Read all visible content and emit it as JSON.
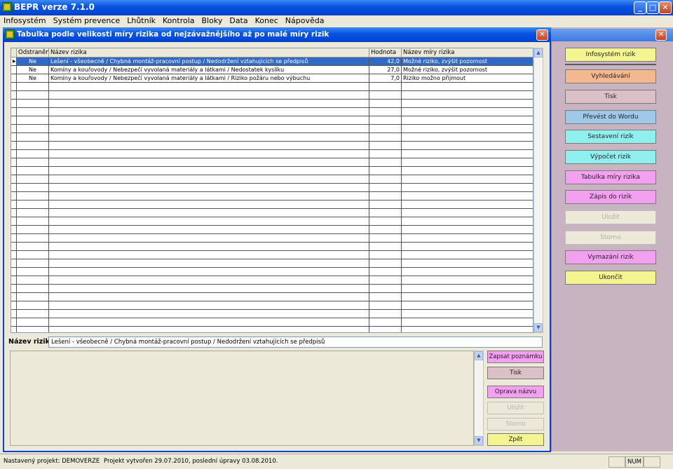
{
  "app": {
    "title": "BEPR verze 7.1.0"
  },
  "menu": [
    "Infosystém",
    "Systém prevence",
    "Lhůtník",
    "Kontrola",
    "Bloky",
    "Data",
    "Konec",
    "Nápověda"
  ],
  "subwindow": {
    "title": "Tabulka podle velikosti míry rizika od nejzávažnějšího až po malé míry rizik"
  },
  "grid": {
    "columns": [
      "Odstraněno",
      "Název rizika",
      "Hodnota",
      "Název míry rizika"
    ],
    "rows": [
      {
        "odstraneno": "Ne",
        "nazev": "Lešení - všeobecně / Chybná montáž-pracovní postup / Nedodržení vztahujících se předpisů",
        "hodnota": "42,0",
        "mira": "Možné riziko, zvýšit pozornost",
        "selected": true
      },
      {
        "odstraneno": "Ne",
        "nazev": "Komíny a kouřovody / Nebezpečí vyvolaná materiály a látkami / Nedostatek kyslíku",
        "hodnota": "27,0",
        "mira": "Možné riziko, zvýšit pozornost",
        "selected": false
      },
      {
        "odstraneno": "Ne",
        "nazev": "Komíny a kouřovody / Nebezpečí vyvolaná materiály a látkami / Riziko požáru nebo výbuchu",
        "hodnota": "7,0",
        "mira": "Riziko možno přijmout",
        "selected": false
      }
    ]
  },
  "name_field": {
    "label": "Název rizika",
    "value": "Lešení - všeobecně / Chybná montáž-pracovní postup / Nedodržení vztahujících se předpisů"
  },
  "bottom_buttons": [
    {
      "label": "Zapsat poznámku",
      "color": "#f4a0f0",
      "enabled": true
    },
    {
      "label": "Tisk",
      "color": "#dcc0c8",
      "enabled": true
    },
    {
      "label": "Oprava názvu",
      "color": "#f4a0f0",
      "enabled": true
    },
    {
      "label": "Uložit",
      "color": "#ece9d8",
      "enabled": false
    },
    {
      "label": "Storno",
      "color": "#ece9d8",
      "enabled": false
    },
    {
      "label": "Zpět",
      "color": "#f4f490",
      "enabled": true
    }
  ],
  "right_buttons": [
    {
      "label": "Infosystém rizik",
      "color": "#f4f490",
      "enabled": true
    },
    {
      "label": "Vyhledávání",
      "color": "#f4b890",
      "enabled": true
    },
    {
      "label": "Tisk",
      "color": "#dcc0c8",
      "enabled": true
    },
    {
      "label": "Převést do Wordu",
      "color": "#a0c8e8",
      "enabled": true
    },
    {
      "label": "Sestavení rizik",
      "color": "#90f0f0",
      "enabled": true
    },
    {
      "label": "Výpočet rizik",
      "color": "#90f0f0",
      "enabled": true
    },
    {
      "label": "Tabulka míry rizika",
      "color": "#f4a0f0",
      "enabled": true
    },
    {
      "label": "Zápis do rizik",
      "color": "#f4a0f0",
      "enabled": true
    },
    {
      "label": "Uložit",
      "color": "#ece9d8",
      "enabled": false
    },
    {
      "label": "Storno",
      "color": "#ece9d8",
      "enabled": false
    },
    {
      "label": "Vymazání rizik",
      "color": "#f4a0f0",
      "enabled": true
    },
    {
      "label": "Ukončit",
      "color": "#f4f490",
      "enabled": true
    }
  ],
  "status": {
    "project": "Nastavený projekt: DEMOVERZE",
    "created": "Projekt vytvořen 29.07.2010, poslední úpravy 03.08.2010.",
    "num": "NUM"
  }
}
